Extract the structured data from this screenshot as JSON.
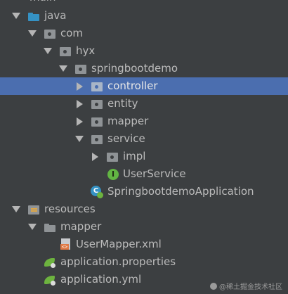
{
  "tree": {
    "top_partial": "main",
    "rows": [
      {
        "label": "java",
        "icon": "blue-source-folder-icon",
        "expanded": true
      },
      {
        "label": "com",
        "icon": "package-icon",
        "expanded": true
      },
      {
        "label": "hyx",
        "icon": "package-icon",
        "expanded": true
      },
      {
        "label": "springbootdemo",
        "icon": "package-icon",
        "expanded": true
      },
      {
        "label": "controller",
        "icon": "package-icon",
        "expanded": false,
        "selected": true
      },
      {
        "label": "entity",
        "icon": "package-icon",
        "expanded": false
      },
      {
        "label": "mapper",
        "icon": "package-icon",
        "expanded": false
      },
      {
        "label": "service",
        "icon": "package-icon",
        "expanded": true
      },
      {
        "label": "impl",
        "icon": "package-icon",
        "expanded": false
      },
      {
        "label": "UserService",
        "icon": "interface-icon",
        "icon_letter": "I"
      },
      {
        "label": "SpringbootdemoApplication",
        "icon": "spring-boot-class-icon",
        "icon_letter": "C"
      },
      {
        "label": "resources",
        "icon": "resources-folder-icon",
        "expanded": true
      },
      {
        "label": "mapper",
        "icon": "folder-icon",
        "expanded": true
      },
      {
        "label": "UserMapper.xml",
        "icon": "xml-file-icon",
        "icon_text": "<>"
      },
      {
        "label": "application.properties",
        "icon": "spring-config-icon"
      },
      {
        "label": "application.yml",
        "icon": "spring-config-icon"
      }
    ]
  },
  "watermark": "@稀土掘金技术社区",
  "colors": {
    "background": "#3c3f41",
    "selection": "#4b6eaf",
    "text": "#bbbbbb",
    "source_folder": "#3592c4",
    "interface": "#62b543",
    "spring_leaf": "#6db33f"
  }
}
